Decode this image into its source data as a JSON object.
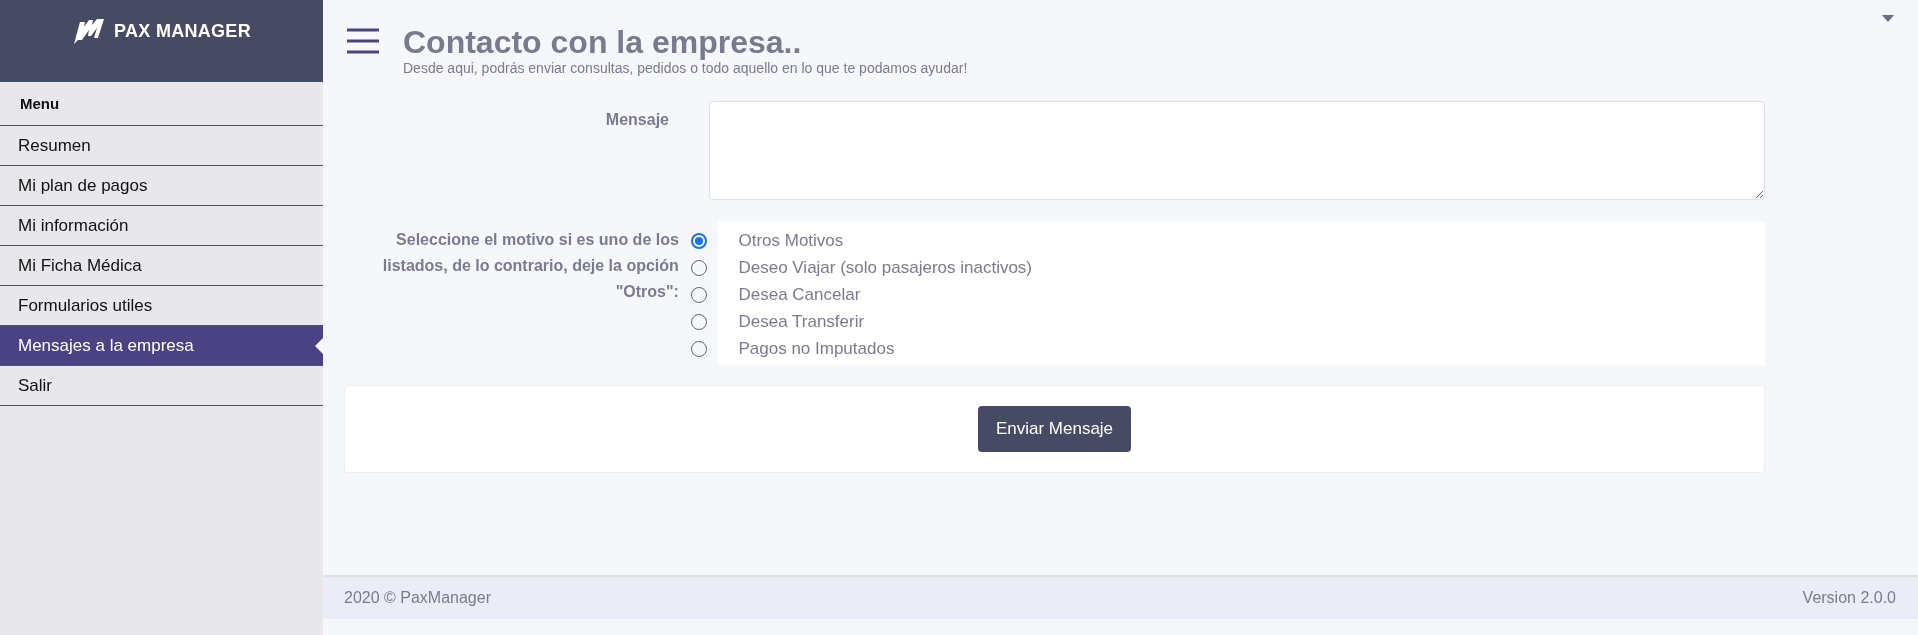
{
  "brand": {
    "name": "PAX MANAGER"
  },
  "sidebar": {
    "heading": "Menu",
    "items": [
      {
        "label": "Resumen",
        "selected": false
      },
      {
        "label": "Mi plan de pagos",
        "selected": false
      },
      {
        "label": "Mi información",
        "selected": false
      },
      {
        "label": "Mi Ficha Médica",
        "selected": false
      },
      {
        "label": "Formularios utiles",
        "selected": false
      },
      {
        "label": "Mensajes a la empresa",
        "selected": true
      },
      {
        "label": "Salir",
        "selected": false
      }
    ]
  },
  "header": {
    "title": "Contacto con la empresa..",
    "subtitle": "Desde aqui, podrás enviar consultas, pedidos o todo aquello en lo que te podamos ayudar!"
  },
  "form": {
    "message_label": "Mensaje",
    "reason_label": "Seleccione el motivo si es uno de los listados, de lo contrario, deje la opción \"Otros\":",
    "reasons": [
      {
        "label": "Otros Motivos",
        "selected": true
      },
      {
        "label": "Deseo Viajar (solo pasajeros inactivos)",
        "selected": false
      },
      {
        "label": "Desea Cancelar",
        "selected": false
      },
      {
        "label": "Desea Transferir",
        "selected": false
      },
      {
        "label": "Pagos no Imputados",
        "selected": false
      }
    ],
    "submit": "Enviar Mensaje"
  },
  "footer": {
    "copyright": "2020 © PaxManager",
    "version": "Version 2.0.0"
  }
}
